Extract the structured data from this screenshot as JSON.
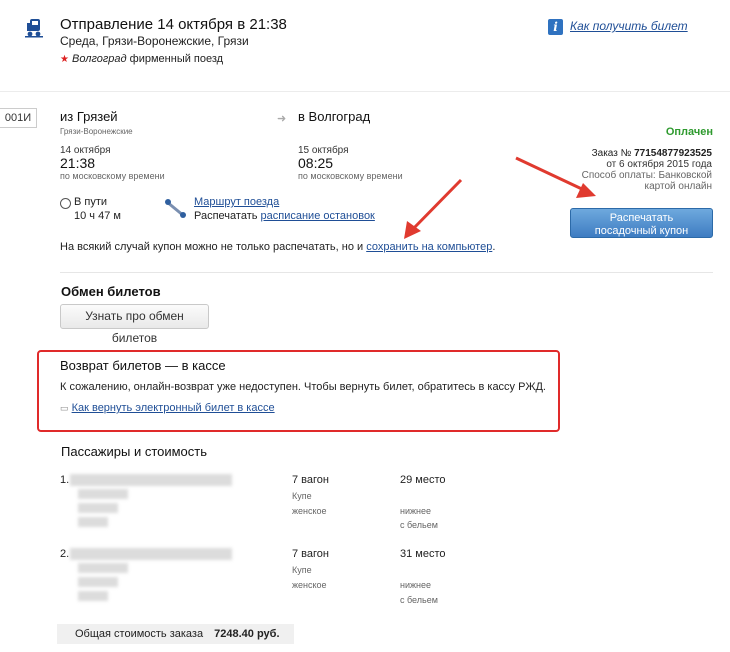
{
  "header": {
    "title": "Отправление 14 октября в 21:38",
    "subtitle": "Среда, Грязи-Воронежские, Грязи",
    "train_name": "Волгоград",
    "train_type": "фирменный поезд",
    "help_link": "Как получить билет"
  },
  "trip": {
    "train_number": "001И",
    "from_label": "из Грязей",
    "from_station": "Грязи-Воронежские",
    "to_label": "в Волгоград",
    "dep_date": "14 октября",
    "dep_time": "21:38",
    "dep_tz": "по московскому времени",
    "arr_date": "15 октября",
    "arr_time": "08:25",
    "arr_tz": "по московскому времени",
    "in_way_label": "В пути",
    "duration": "10 ч 47 м",
    "route_link": "Маршрут поезда",
    "print_prefix": "Распечатать",
    "stops_link": "расписание остановок",
    "coupon_text": "На всякий случай купон можно не только распечатать, но и",
    "save_link": "сохранить на компьютер",
    "dot": "."
  },
  "order": {
    "status": "Оплачен",
    "order_label": "Заказ №",
    "order_number": "77154877923525",
    "order_date": "от 6 октября 2015 года",
    "payment_line1": "Способ оплаты: Банковской",
    "payment_line2": "картой онлайн",
    "print_btn_line1": "Распечатать",
    "print_btn_line2": "посадочный купон"
  },
  "exchange": {
    "title": "Обмен билетов",
    "button": "Узнать про обмен билетов"
  },
  "refund": {
    "title": "Возврат билетов — в кассе",
    "text": "К сожалению, онлайн-возврат уже недоступен. Чтобы вернуть билет, обратитесь в кассу РЖД.",
    "link": "Как вернуть электронный билет в кассе"
  },
  "passengers": {
    "title": "Пассажиры и стоимость",
    "items": [
      {
        "num": "1.",
        "car": "7 вагон",
        "car_type": "Купе",
        "gender": "женское",
        "seat": "29 место",
        "berth": "нижнее",
        "linen": "с бельем"
      },
      {
        "num": "2.",
        "car": "7 вагон",
        "car_type": "Купе",
        "gender": "женское",
        "seat": "31 место",
        "berth": "нижнее",
        "linen": "с бельем"
      }
    ],
    "total_label": "Общая стоимость заказа",
    "total_value": "7248.40 руб."
  },
  "colors": {
    "paid": "#2e9a2e",
    "refund_border": "#e02a2a",
    "link": "#1f4e96",
    "accent_arrow": "#e03a2f",
    "button_blue": "#3e7cc2"
  }
}
